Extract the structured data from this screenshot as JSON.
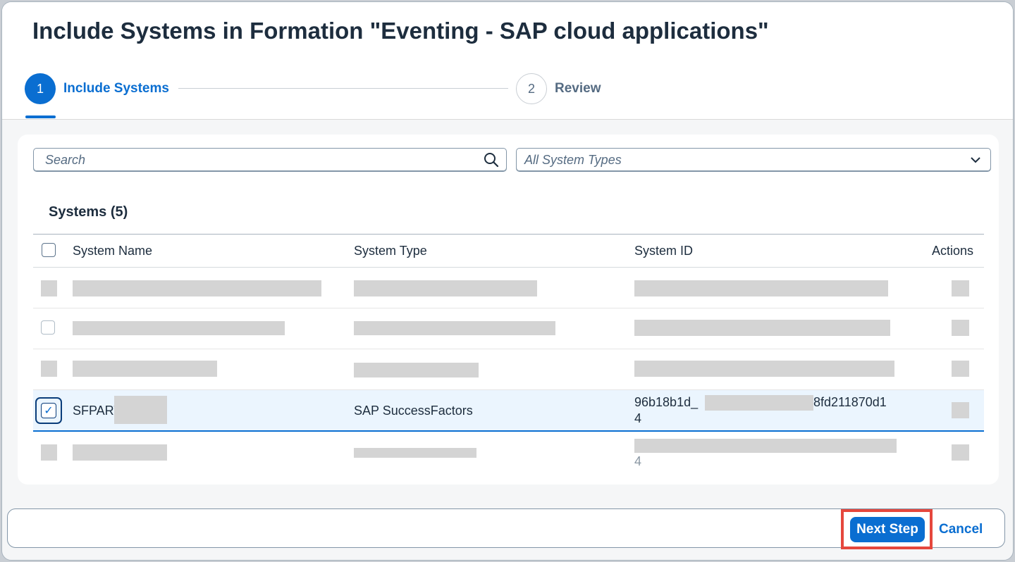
{
  "dialog": {
    "title": "Include Systems in Formation \"Eventing - SAP cloud applications\"",
    "steps": [
      {
        "number": "1",
        "label": "Include Systems",
        "state": "active"
      },
      {
        "number": "2",
        "label": "Review",
        "state": "inactive"
      }
    ]
  },
  "filters": {
    "search_placeholder": "Search",
    "system_type_selected": "All System Types"
  },
  "table": {
    "title": "Systems (5)",
    "columns": [
      "System Name",
      "System Type",
      "System ID",
      "Actions"
    ],
    "rows": [
      {
        "name": "",
        "type": "",
        "id": "",
        "redacted": true
      },
      {
        "name": "",
        "type": "",
        "id": "",
        "redacted": true
      },
      {
        "name": "",
        "type": "",
        "id": "",
        "redacted": true
      },
      {
        "name": "SFPART",
        "type": "SAP SuccessFactors",
        "id_start": "96b18b1d_",
        "id_end": "8fd211870d1",
        "id_line2": "4",
        "selected": true
      },
      {
        "name": "",
        "type": "",
        "id": "",
        "id_line2": "4",
        "redacted": true
      }
    ]
  },
  "footer": {
    "next_label": "Next Step",
    "cancel_label": "Cancel"
  },
  "colors": {
    "accent": "#0a6ed1",
    "highlight": "#e5473d"
  }
}
